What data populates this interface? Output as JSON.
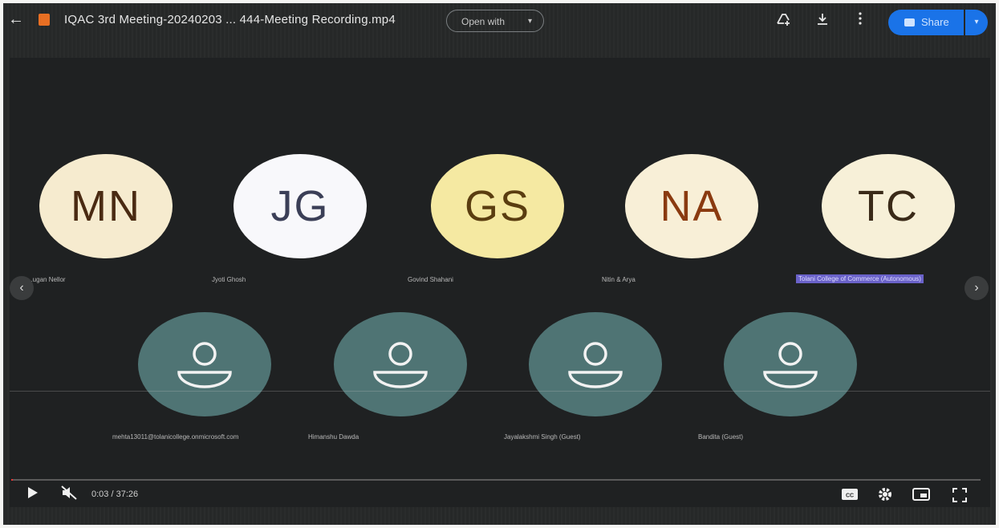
{
  "header": {
    "file_title": "IQAC 3rd Meeting-20240203 ... 444-Meeting Recording.mp4",
    "open_with_label": "Open with",
    "share_label": "Share"
  },
  "participants_named": [
    {
      "initials": "MN",
      "name": "...ugan Nellor",
      "bg": "#f6ebcf",
      "fg": "#4a2a12"
    },
    {
      "initials": "JG",
      "name": "Jyoti Ghosh",
      "bg": "#f8f8fb",
      "fg": "#3b3f57"
    },
    {
      "initials": "GS",
      "name": "Govind Shahani",
      "bg": "#f5e9a2",
      "fg": "#5a3d10"
    },
    {
      "initials": "NA",
      "name": "Nitin & Arya",
      "bg": "#f8efd7",
      "fg": "#8a3a10"
    },
    {
      "initials": "TC",
      "name": "Tolani College of Commerce (Autonomous)",
      "bg": "#f7f0d8",
      "fg": "#3a2a18"
    }
  ],
  "participants_guests": [
    {
      "name": "mehta13011@tolanicollege.onmicrosoft.com"
    },
    {
      "name": "Himanshu Dawda"
    },
    {
      "name": "Jayalakshmi Singh (Guest)"
    },
    {
      "name": "Bandita (Guest)"
    }
  ],
  "player": {
    "time": "0:03 / 37:26",
    "progress": 0.0013
  },
  "icons": {
    "back": "back-arrow-icon",
    "add_drive": "add-to-drive-icon",
    "download": "download-icon",
    "more": "more-vert-icon",
    "play": "play-icon",
    "mute": "volume-muted-icon",
    "cc": "captions-icon",
    "settings": "settings-gear-icon",
    "miniplayer": "miniplayer-icon",
    "fullscreen": "fullscreen-icon"
  },
  "colors": {
    "share_button": "#1a73e8",
    "guest_avatar": "#4f7474",
    "highlight_name": "#6a62c9"
  }
}
